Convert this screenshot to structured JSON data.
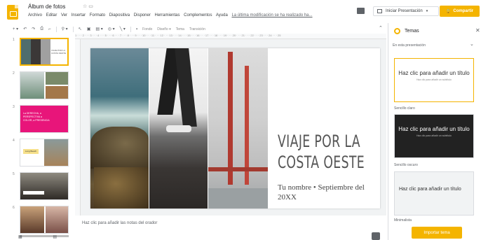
{
  "app": {
    "doc_title": "Álbum de fotos",
    "title_icons": "☆  ▭",
    "last_edit": "La última modificación se ha realizado ha...",
    "menu": [
      "Archivo",
      "Editar",
      "Ver",
      "Insertar",
      "Formato",
      "Diapositiva",
      "Disponer",
      "Herramientas",
      "Complementos",
      "Ayuda"
    ],
    "present_label": "Iniciar Presentación",
    "share_label": "Compartir"
  },
  "toolbar": {
    "background_label": "Fondo",
    "layout_label": "Diseño ▾",
    "theme_label": "Tema",
    "transition_label": "Transición",
    "ruler_ticks": "1 · · · 2 · · · 3 · · · 4 · · · 5 · · · 6 · · · 7 · · · 8 · · · 9 · · · 10 · · · 11 · · · 12 · · · 13 · · · 14 · · · 15 · · · 16 · · · 17 · · · 18 · · · 19 · · · 20 · · · 21 · · · 22 · · · 23 · · · 24 · · · 25"
  },
  "slides": [
    {
      "num": "1",
      "text": "VIAJE POR LA COSTA OESTE"
    },
    {
      "num": "2",
      "text": ""
    },
    {
      "num": "3",
      "text": "La DERECHA, a PERSPECTIVA a COLOR, a PRESENCIA"
    },
    {
      "num": "4",
      "text": "Long Beach"
    },
    {
      "num": "5",
      "text": ""
    },
    {
      "num": "6",
      "text": ""
    }
  ],
  "main_slide": {
    "title_line1": "VIAJE POR LA",
    "title_line2": "COSTA OESTE",
    "subtitle": "Tu nombre • Septiembre del 20XX"
  },
  "notes_placeholder": "Haz clic para añadir las notas del orador",
  "themes": {
    "header": "Temas",
    "section_label": "En esta presentación",
    "cards": [
      {
        "title": "Haz clic para añadir un título",
        "subtitle": "Haz clic para añadir un subtítulo",
        "label": "Sencillo claro"
      },
      {
        "title": "Haz clic para añadir un título",
        "subtitle": "Haz clic para añadir un subtítulo",
        "label": "Sencillo oscuro"
      },
      {
        "title": "Haz clic para añadir un título",
        "subtitle": "",
        "label": "Minimalista"
      }
    ],
    "import_label": "Importar tema"
  }
}
